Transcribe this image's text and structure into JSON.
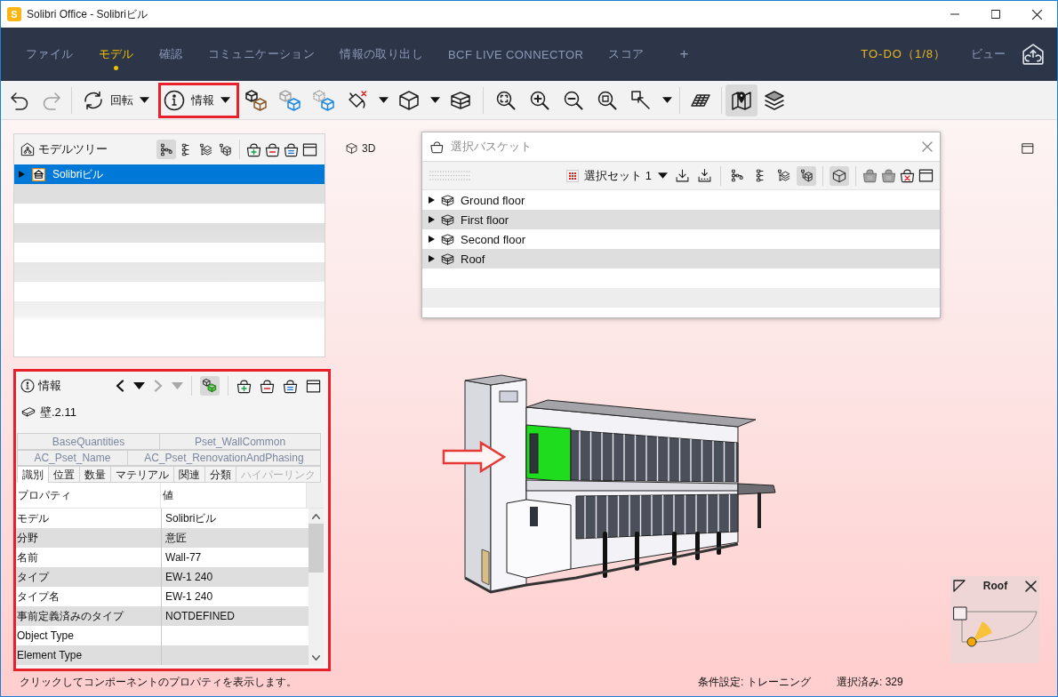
{
  "window": {
    "logo": "S",
    "title": "Solibri Office - Solibriビル"
  },
  "menu": {
    "tabs": [
      {
        "label": "ファイル",
        "selected": false
      },
      {
        "label": "モデル",
        "selected": true
      },
      {
        "label": "確認",
        "selected": false
      },
      {
        "label": "コミュニケーション",
        "selected": false
      },
      {
        "label": "情報の取り出し",
        "selected": false
      },
      {
        "label": "BCF LIVE CONNECTOR",
        "selected": false
      },
      {
        "label": "スコア",
        "selected": false
      }
    ],
    "add_tab": "+",
    "todo": "TO-DO（1/8）",
    "view": "ビュー"
  },
  "toolbar": {
    "undo_disabled": false,
    "redo_disabled": true,
    "rotate_label": "回転",
    "info_label": "情報",
    "info_highlighted": true,
    "map_view_selected": true
  },
  "model_tree": {
    "title": "モデルツリー",
    "view_modes": [
      {
        "selected": true
      },
      {
        "selected": false
      },
      {
        "selected": false
      },
      {
        "selected": false
      }
    ],
    "items": [
      {
        "label": "Solibriビル",
        "selected": true,
        "expanded": false
      }
    ]
  },
  "info_panel": {
    "title": "情報",
    "highlighted": true,
    "back_disabled": false,
    "forward_disabled": true,
    "selection_filter_on": true,
    "component": "壁.2.11",
    "tab_rows": [
      {
        "tabs": [
          {
            "label": "BaseQuantities",
            "selected": false,
            "disabled": false
          },
          {
            "label": "Pset_WallCommon",
            "selected": false,
            "disabled": false
          }
        ]
      },
      {
        "tabs": [
          {
            "label": "AC_Pset_Name",
            "selected": false,
            "disabled": false
          },
          {
            "label": "AC_Pset_RenovationAndPhasing",
            "selected": false,
            "disabled": false
          }
        ]
      },
      {
        "tabs": [
          {
            "label": "識別",
            "selected": true,
            "disabled": false
          },
          {
            "label": "位置",
            "selected": false,
            "disabled": false
          },
          {
            "label": "数量",
            "selected": false,
            "disabled": false
          },
          {
            "label": "マテリアル",
            "selected": false,
            "disabled": false
          },
          {
            "label": "関連",
            "selected": false,
            "disabled": false
          },
          {
            "label": "分類",
            "selected": false,
            "disabled": false
          },
          {
            "label": "ハイパーリンク",
            "selected": false,
            "disabled": true
          }
        ]
      }
    ],
    "table": {
      "columns": [
        "プロパティ",
        "値"
      ],
      "rows": [
        {
          "property": "モデル",
          "value": "Solibriビル"
        },
        {
          "property": "分野",
          "value": "意匠"
        },
        {
          "property": "名前",
          "value": "Wall-77"
        },
        {
          "property": "タイプ",
          "value": "EW-1 240"
        },
        {
          "property": "タイプ名",
          "value": "EW-1 240"
        },
        {
          "property": "事前定義済みのタイプ",
          "value": "NOTDEFINED"
        },
        {
          "property": "Object Type"
        },
        {
          "property": "Element Type"
        }
      ]
    }
  },
  "viewport": {
    "label": "3D",
    "selection_basket": {
      "title": "選択バスケット",
      "set_name": "選択セット 1",
      "view_modes": [
        {
          "selected": false
        },
        {
          "selected": false
        },
        {
          "selected": false
        },
        {
          "selected": true
        }
      ],
      "show_3d_selected": true,
      "items": [
        {
          "label": "Ground floor",
          "expanded": false
        },
        {
          "label": "First floor",
          "expanded": false
        },
        {
          "label": "Second floor",
          "expanded": false
        },
        {
          "label": "Roof",
          "expanded": false
        }
      ]
    },
    "floor_plan": {
      "title": "Roof"
    }
  },
  "status_bar": {
    "hint": "クリックしてコンポーネントのプロパティを表示します。",
    "condition": "条件設定: トレーニング",
    "selected_count": "選択済み: 329"
  }
}
